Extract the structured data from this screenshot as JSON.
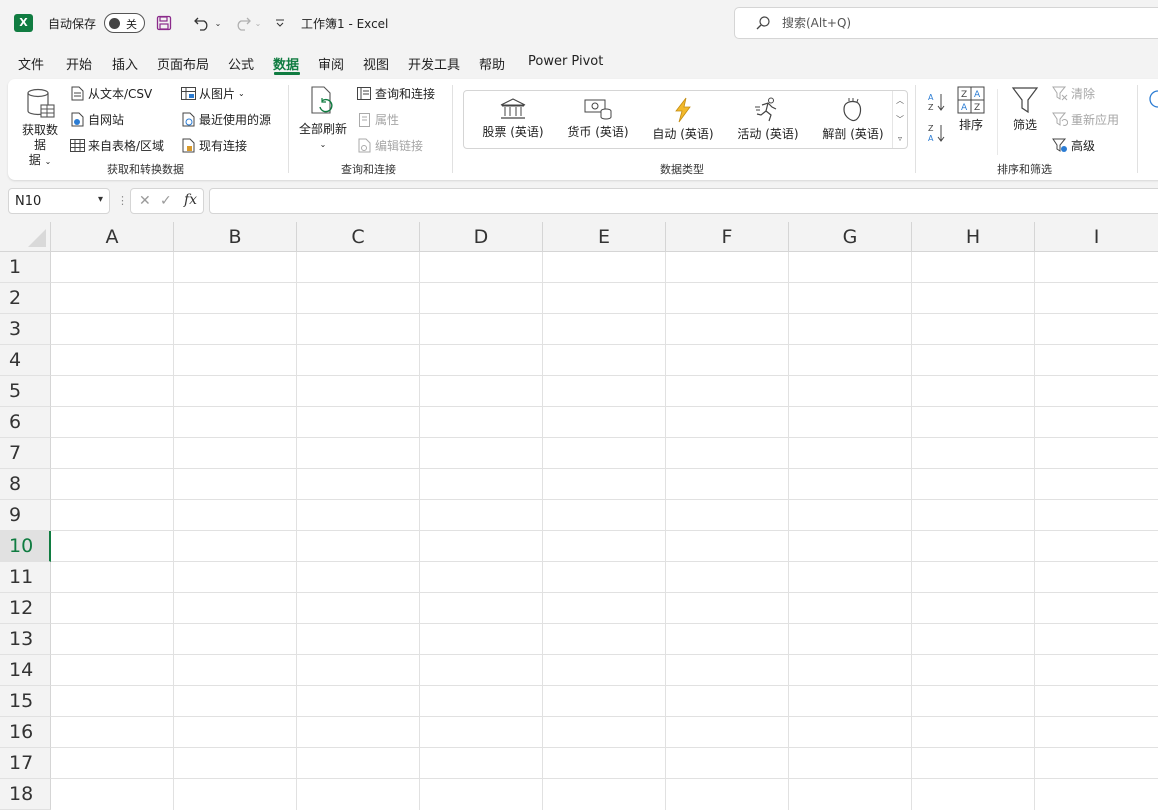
{
  "titlebar": {
    "app_logo": "X",
    "autosave_label": "自动保存",
    "autosave_state": "关",
    "doc_title": "工作簿1  -  Excel",
    "search_placeholder": "搜索(Alt+Q)"
  },
  "tabs": [
    "文件",
    "开始",
    "插入",
    "页面布局",
    "公式",
    "数据",
    "审阅",
    "视图",
    "开发工具",
    "帮助",
    "Power Pivot"
  ],
  "active_tab": "数据",
  "ribbon": {
    "get_data": {
      "big_button": "获取数据",
      "big_button_line2": "据",
      "from_text_csv": "从文本/CSV",
      "from_web": "自网站",
      "from_table": "来自表格/区域",
      "from_picture": "从图片",
      "recent_sources": "最近使用的源",
      "existing_connections": "现有连接",
      "group_label": "获取和转换数据"
    },
    "queries": {
      "refresh_all_line1": "全部刷新",
      "queries_connections": "查询和连接",
      "properties": "属性",
      "edit_links": "编辑链接",
      "group_label": "查询和连接"
    },
    "data_types": {
      "items": [
        "股票 (英语)",
        "货币 (英语)",
        "自动 (英语)",
        "活动 (英语)",
        "解剖 (英语)"
      ],
      "group_label": "数据类型"
    },
    "sort_filter": {
      "sort": "排序",
      "filter": "筛选",
      "clear": "清除",
      "reapply": "重新应用",
      "advanced": "高级",
      "group_label": "排序和筛选"
    }
  },
  "formula_bar": {
    "name_box": "N10",
    "formula": ""
  },
  "grid": {
    "columns": [
      "A",
      "B",
      "C",
      "D",
      "E",
      "F",
      "G",
      "H",
      "I"
    ],
    "rows": [
      "1",
      "2",
      "3",
      "4",
      "5",
      "6",
      "7",
      "8",
      "9",
      "10",
      "11",
      "12",
      "13",
      "14",
      "15",
      "16",
      "17",
      "18"
    ],
    "selected_row": "10"
  },
  "colors": {
    "accent": "#107c41",
    "ribbon_bg": "#ffffff",
    "chrome_bg": "#f3f3f3"
  }
}
